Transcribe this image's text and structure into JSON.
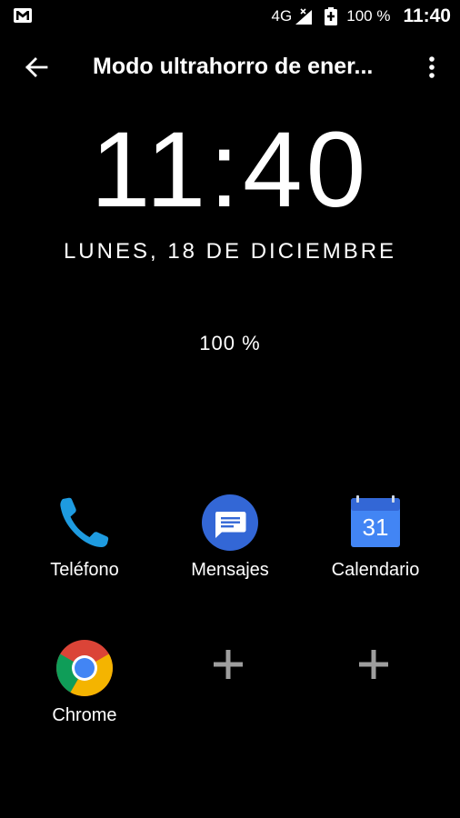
{
  "status_bar": {
    "notification_icon": "gmail-icon",
    "network": "4G",
    "signal_icon": "signal-icon",
    "battery_icon": "battery-charging-icon",
    "battery_text": "100 %",
    "time": "11:40"
  },
  "app_bar": {
    "back_icon": "arrow-back-icon",
    "title": "Modo ultrahorro de ener...",
    "more_icon": "more-vert-icon"
  },
  "lockscreen": {
    "clock": "11:40",
    "date": "LUNES, 18 DE DICIEMBRE",
    "battery_percent": "100 %"
  },
  "apps": [
    {
      "label": "Teléfono",
      "icon": "phone-icon",
      "color": "#1e9be0"
    },
    {
      "label": "Mensajes",
      "icon": "messages-icon",
      "color": "#3367d6"
    },
    {
      "label": "Calendario",
      "icon": "calendar-icon",
      "color": "#4285f4",
      "day": "31"
    },
    {
      "label": "Chrome",
      "icon": "chrome-icon",
      "color": "#db4437"
    }
  ],
  "add_slots": [
    {
      "icon": "add-icon",
      "color": "#9e9e9e"
    },
    {
      "icon": "add-icon",
      "color": "#9e9e9e"
    }
  ]
}
